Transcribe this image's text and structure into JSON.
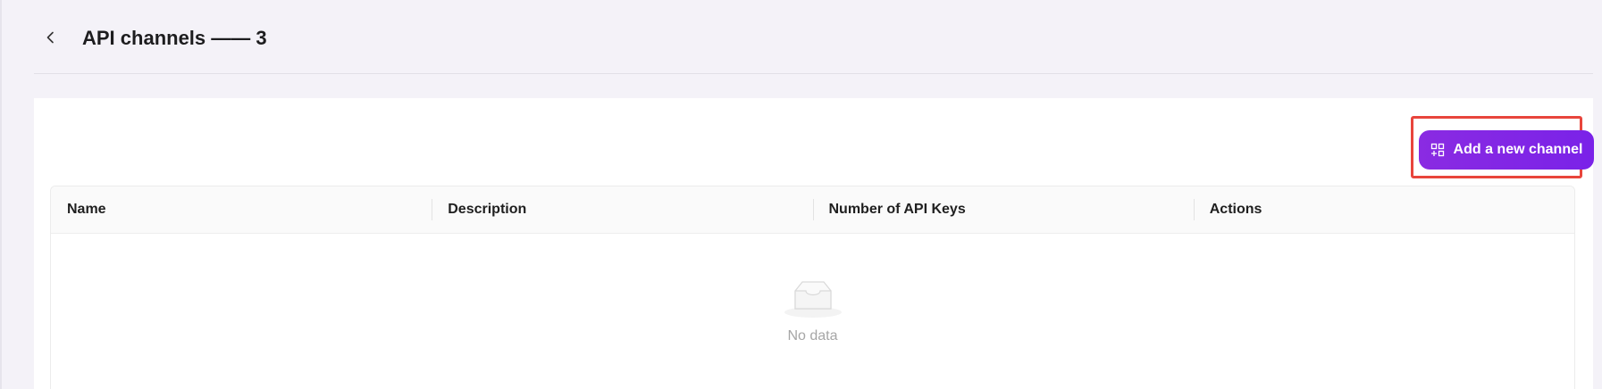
{
  "header": {
    "title": "API channels —— 3",
    "back_icon": "chevron-left-icon"
  },
  "toolbar": {
    "add_label": "Add a new channel",
    "add_icon": "grid-add-icon",
    "accent_color": "#8a2be2",
    "highlight_color": "#e8453c"
  },
  "table": {
    "columns": [
      "Name",
      "Description",
      "Number of API Keys",
      "Actions"
    ],
    "rows": [],
    "empty_text": "No data",
    "empty_icon": "empty-inbox-icon"
  }
}
